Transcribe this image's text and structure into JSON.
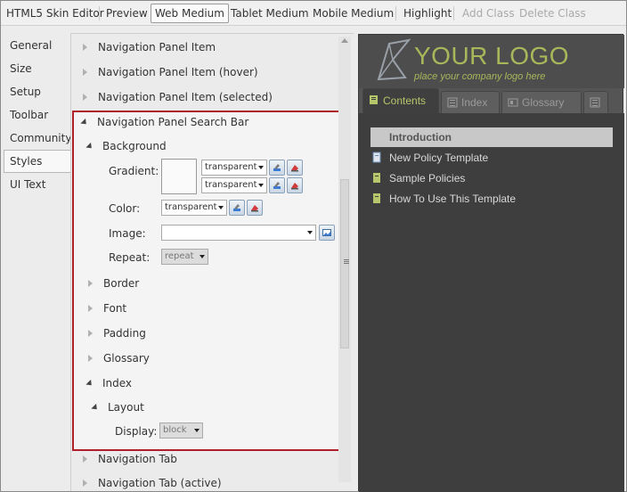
{
  "toolbar": {
    "title": "HTML5 Skin Editor",
    "preview": "Preview",
    "web_medium": "Web Medium",
    "tablet_medium": "Tablet Medium",
    "mobile_medium": "Mobile Medium",
    "highlight": "Highlight",
    "add_class": "Add Class",
    "delete_class": "Delete Class"
  },
  "sidebar": {
    "items": [
      {
        "label": "General"
      },
      {
        "label": "Size"
      },
      {
        "label": "Setup"
      },
      {
        "label": "Toolbar"
      },
      {
        "label": "Community"
      },
      {
        "label": "Styles"
      },
      {
        "label": "UI Text"
      }
    ],
    "selected": "Styles"
  },
  "tree": {
    "nav_item": "Navigation Panel Item",
    "nav_item_hover": "Navigation Panel Item (hover)",
    "nav_item_selected": "Navigation Panel Item (selected)",
    "search_bar": "Navigation Panel Search Bar",
    "background": "Background",
    "gradient_label": "Gradient:",
    "gradient_top": "transparent",
    "gradient_bottom": "transparent",
    "color_label": "Color:",
    "color_value": "transparent",
    "image_label": "Image:",
    "image_value": "",
    "repeat_label": "Repeat:",
    "repeat_value": "repeat",
    "border": "Border",
    "font": "Font",
    "padding": "Padding",
    "glossary": "Glossary",
    "index": "Index",
    "layout": "Layout",
    "display_label": "Display:",
    "display_value": "block",
    "nav_tab": "Navigation Tab",
    "nav_tab_active": "Navigation Tab (active)"
  },
  "preview": {
    "logo_text": "YOUR LOGO",
    "logo_sub": "place your company logo here",
    "tabs": [
      {
        "label": "Contents",
        "active": true
      },
      {
        "label": "Index",
        "active": false
      },
      {
        "label": "Glossary",
        "active": false
      }
    ],
    "toc": {
      "intro": "Introduction",
      "items": [
        {
          "label": "New Policy Template"
        },
        {
          "label": "Sample Policies"
        },
        {
          "label": "How To Use This Template"
        }
      ]
    },
    "colors": {
      "accent": "#a7b85a",
      "background": "#3e3e3e",
      "highlight_box": "#b0202a"
    }
  }
}
